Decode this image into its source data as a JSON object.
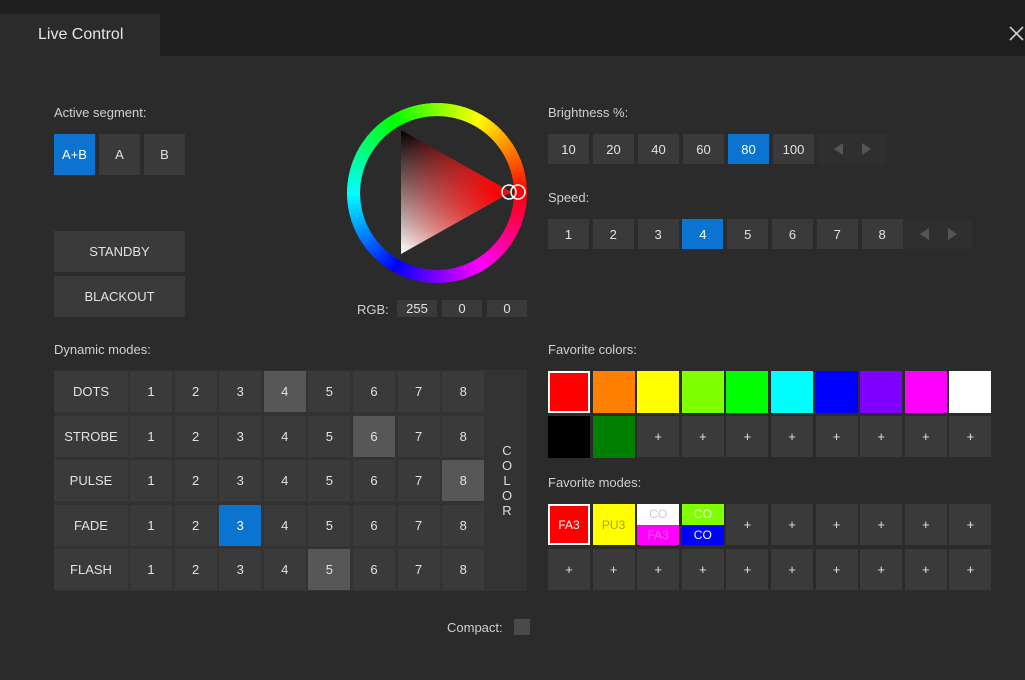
{
  "window": {
    "tab_title": "Live Control",
    "close_label": "✕"
  },
  "segment": {
    "label": "Active segment:",
    "options": [
      "A+B",
      "A",
      "B"
    ],
    "active": "A+B"
  },
  "actions": {
    "standby": "STANDBY",
    "blackout": "BLACKOUT"
  },
  "color_picker": {
    "rgb_label": "RGB:",
    "r": "255",
    "g": "0",
    "b": "0"
  },
  "brightness": {
    "label": "Brightness %:",
    "options": [
      "10",
      "20",
      "40",
      "60",
      "80",
      "100"
    ],
    "active": "80"
  },
  "speed": {
    "label": "Speed:",
    "options": [
      "1",
      "2",
      "3",
      "4",
      "5",
      "6",
      "7",
      "8"
    ],
    "active": "4"
  },
  "dynamic_modes": {
    "label": "Dynamic modes:",
    "color_button": "COLOR",
    "rows": [
      {
        "name": "DOTS",
        "steps": [
          "1",
          "2",
          "3",
          "4",
          "5",
          "6",
          "7",
          "8"
        ],
        "highlight": "4",
        "active": ""
      },
      {
        "name": "STROBE",
        "steps": [
          "1",
          "2",
          "3",
          "4",
          "5",
          "6",
          "7",
          "8"
        ],
        "highlight": "6",
        "active": ""
      },
      {
        "name": "PULSE",
        "steps": [
          "1",
          "2",
          "3",
          "4",
          "5",
          "6",
          "7",
          "8"
        ],
        "highlight": "8",
        "active": ""
      },
      {
        "name": "FADE",
        "steps": [
          "1",
          "2",
          "3",
          "4",
          "5",
          "6",
          "7",
          "8"
        ],
        "highlight": "",
        "active": "3"
      },
      {
        "name": "FLASH",
        "steps": [
          "1",
          "2",
          "3",
          "4",
          "5",
          "6",
          "7",
          "8"
        ],
        "highlight": "5",
        "active": ""
      }
    ]
  },
  "favorite_colors": {
    "label": "Favorite colors:",
    "colors": [
      "#ff0000",
      "#ff8000",
      "#ffff00",
      "#80ff00",
      "#00ff00",
      "#00ffff",
      "#0000ff",
      "#8000ff",
      "#ff00ff",
      "#ffffff",
      "#000000",
      "#008000"
    ],
    "selected": "#ff0000",
    "add_label": "+",
    "add_slots": 8
  },
  "favorite_modes": {
    "label": "Favorite modes:",
    "add_label": "+",
    "add_slots_row1": 6,
    "add_slots_row2": 10,
    "chips": [
      {
        "type": "single",
        "text": "FA3",
        "bg": "#ff0000",
        "fg": "#ffffff",
        "selected": true
      },
      {
        "type": "single",
        "text": "PU3",
        "bg": "#ffff00",
        "fg": "#b3a000",
        "selected": false
      },
      {
        "type": "split",
        "top_text": "CO",
        "top_bg": "#ffffff",
        "top_fg": "#cccccc",
        "bottom_text": "FA3",
        "bottom_bg": "#ff00ff",
        "bottom_fg": "#e85ee8"
      },
      {
        "type": "split",
        "top_text": "CO",
        "top_bg": "#80ff00",
        "top_fg": "#eaffd5",
        "bottom_text": "CO",
        "bottom_bg": "#0000ff",
        "bottom_fg": "#ffffff"
      }
    ]
  },
  "compact": {
    "label": "Compact:"
  }
}
